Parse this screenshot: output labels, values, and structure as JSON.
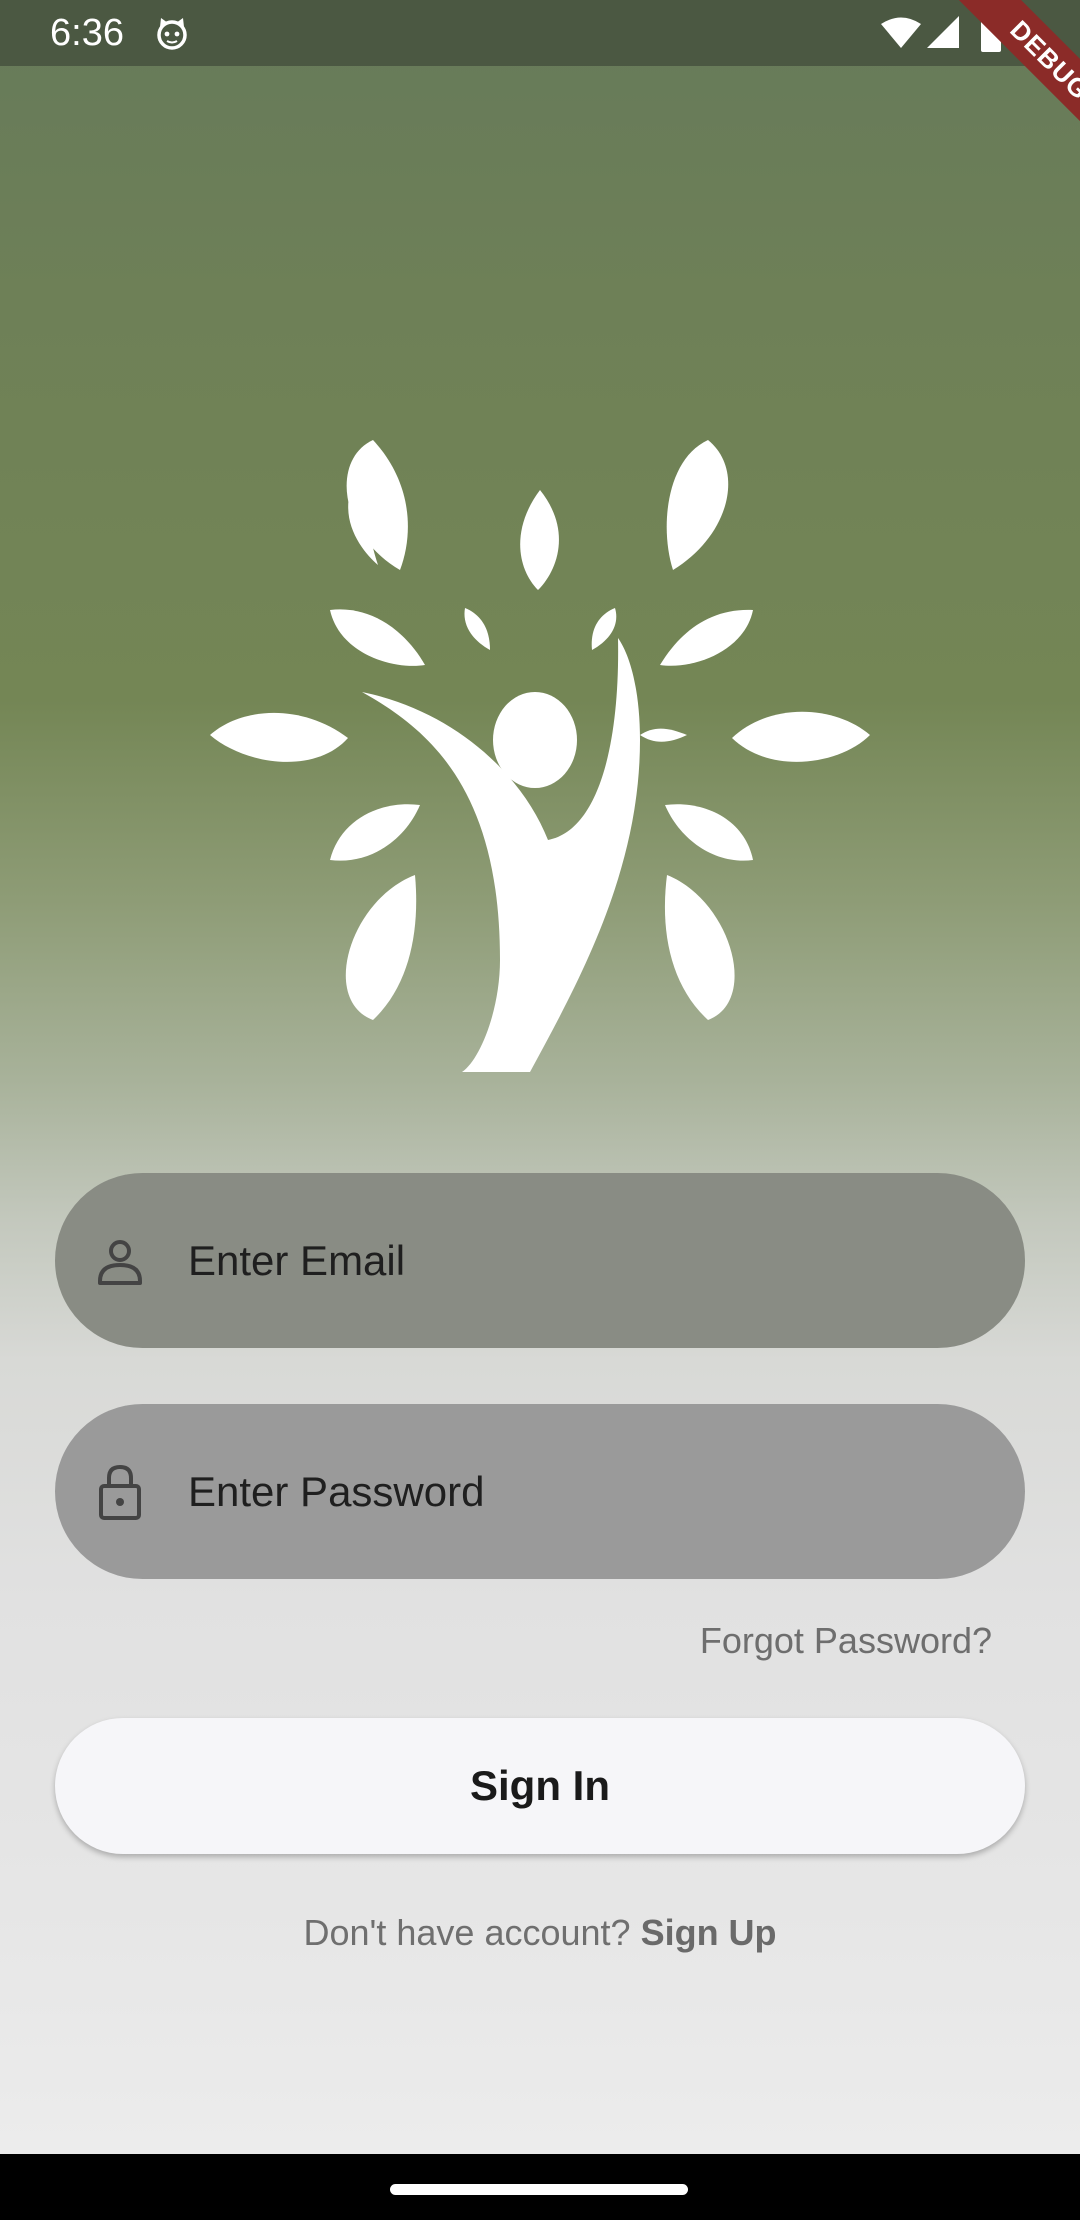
{
  "status_bar": {
    "time": "6:36",
    "icons": [
      "cat-app-icon",
      "wifi-icon",
      "signal-icon",
      "battery-icon"
    ]
  },
  "debug_banner": {
    "label": "DEBUG"
  },
  "login": {
    "email": {
      "placeholder": "Enter Email",
      "value": "",
      "icon": "person-icon"
    },
    "password": {
      "placeholder": "Enter Password",
      "value": "",
      "icon": "lock-icon"
    },
    "forgot_label": "Forgot Password?",
    "signin_label": "Sign In",
    "signup_prompt": "Don't have account?",
    "signup_label": "Sign Up"
  },
  "colors": {
    "gradient_top": "#667a5a",
    "gradient_mid": "#748655",
    "gradient_bottom": "#ececec",
    "email_field": "#898c84",
    "password_field": "#9a9a9a",
    "button_bg": "#f6f6f9",
    "debug_banner": "#8b2b28"
  }
}
